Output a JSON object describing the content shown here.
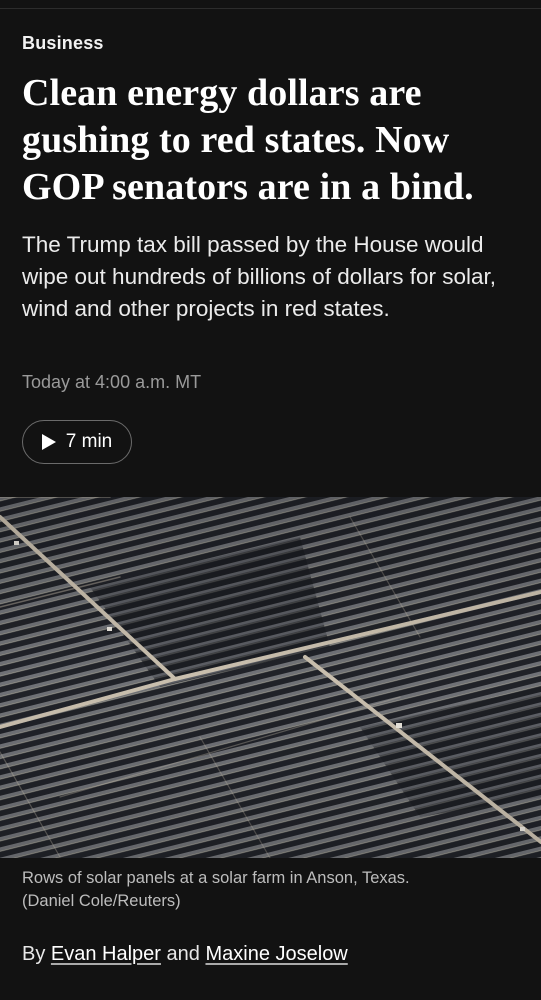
{
  "article": {
    "section": "Business",
    "headline": "Clean energy dollars are gushing to red states. Now GOP senators are in a bind.",
    "dek": "The Trump tax bill passed by the House would wipe out hundreds of billions of dollars for solar, wind and other projects in red states.",
    "timestamp": "Today at 4:00 a.m. MT",
    "audio": {
      "icon": "play-icon",
      "duration": "7 min"
    },
    "photo": {
      "subject": "aerial-solar-farm",
      "caption": "Rows of solar panels at a solar farm in Anson, Texas.",
      "credit": "(Daniel Cole/Reuters)"
    },
    "byline": {
      "prefix": "By",
      "authors": [
        "Evan Halper",
        "Maxine Joselow"
      ],
      "conjunction": "and"
    }
  },
  "colors": {
    "background": "#121212",
    "text": "#ffffff",
    "muted": "#9a9a9a",
    "panel": "#1f2127",
    "road": "#c9bfae"
  }
}
